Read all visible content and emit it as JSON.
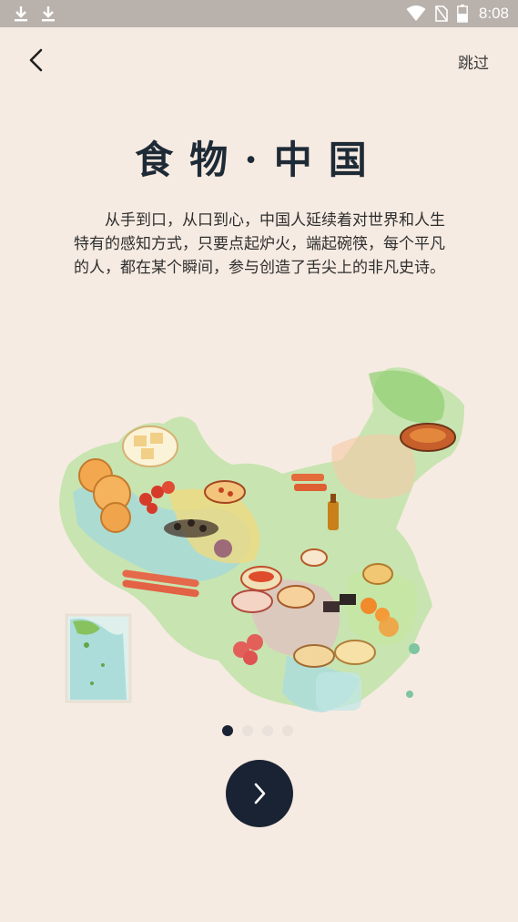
{
  "status_bar": {
    "time": "8:08",
    "icons": [
      "download-icon",
      "download-icon",
      "wifi-icon",
      "no-sim-icon",
      "battery-icon"
    ]
  },
  "header": {
    "back_icon": "chevron-left-icon",
    "skip_label": "跳过"
  },
  "main": {
    "title": "食物·中国",
    "intro": "从手到口，从口到心，中国人延续着对世界和人生特有的感知方式，只要点起炉火，端起碗筷，每个平凡的人，都在某个瞬间，参与创造了舌尖上的非凡史诗。",
    "illustration": "china-food-map-illustration"
  },
  "pager": {
    "page_count": 4,
    "active_index": 0
  },
  "next": {
    "icon": "chevron-right-icon"
  },
  "colors": {
    "background": "#f6ebe2",
    "accent": "#1a2333",
    "status_bar": "#b9b1ac"
  }
}
